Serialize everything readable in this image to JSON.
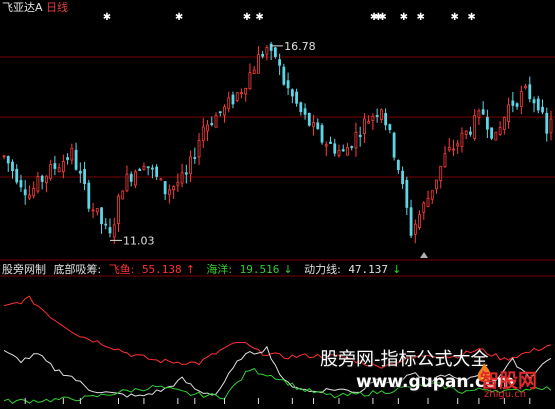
{
  "header": {
    "stock_name": "飞亚达A",
    "period": "日线"
  },
  "price_chart": {
    "high_label": "16.78",
    "low_label": "11.03",
    "ylim": [
      10.6,
      17.6
    ],
    "bar_count": 130,
    "high_index": 63,
    "low_index": 25,
    "anchors": [
      [
        0,
        13.4
      ],
      [
        6,
        12.3
      ],
      [
        10,
        12.9
      ],
      [
        16,
        13.5
      ],
      [
        20,
        12.1
      ],
      [
        25,
        11.03
      ],
      [
        28,
        12.6
      ],
      [
        33,
        13.3
      ],
      [
        38,
        12.4
      ],
      [
        43,
        12.8
      ],
      [
        47,
        14.3
      ],
      [
        52,
        14.8
      ],
      [
        56,
        15.4
      ],
      [
        60,
        16.3
      ],
      [
        63,
        16.78
      ],
      [
        66,
        15.6
      ],
      [
        70,
        14.7
      ],
      [
        75,
        13.9
      ],
      [
        80,
        13.5
      ],
      [
        85,
        14.4
      ],
      [
        89,
        14.9
      ],
      [
        93,
        13.1
      ],
      [
        96,
        11.2
      ],
      [
        100,
        12.2
      ],
      [
        104,
        13.4
      ],
      [
        109,
        14.1
      ],
      [
        113,
        14.7
      ],
      [
        116,
        13.9
      ],
      [
        119,
        14.9
      ],
      [
        123,
        15.3
      ],
      [
        126,
        15.0
      ],
      [
        128,
        14.0
      ],
      [
        129,
        14.6
      ]
    ],
    "star_markers": [
      24,
      41,
      57,
      60,
      87,
      88,
      89,
      94,
      98,
      106,
      110
    ]
  },
  "indicator": {
    "panel_title": "股旁网制",
    "name_label": "底部吸筹:",
    "s1_label": "飞鱼:",
    "s1_value": "55.138",
    "s1_arrow": "↑",
    "s2_label": "海洋:",
    "s2_value": "19.516",
    "s2_arrow": "↓",
    "s3_label": "动力线:",
    "s3_value": "47.137",
    "s3_arrow": "↓",
    "ylim": [
      0,
      100
    ],
    "red_anchors": [
      [
        0,
        78
      ],
      [
        6,
        85
      ],
      [
        12,
        68
      ],
      [
        18,
        55
      ],
      [
        24,
        48
      ],
      [
        30,
        40
      ],
      [
        36,
        35
      ],
      [
        40,
        34
      ],
      [
        46,
        33
      ],
      [
        52,
        45
      ],
      [
        56,
        50
      ],
      [
        60,
        42
      ],
      [
        66,
        38
      ],
      [
        72,
        39
      ],
      [
        80,
        38
      ],
      [
        88,
        30
      ],
      [
        94,
        35
      ],
      [
        100,
        40
      ],
      [
        106,
        38
      ],
      [
        112,
        44
      ],
      [
        118,
        36
      ],
      [
        124,
        42
      ],
      [
        129,
        48
      ]
    ],
    "white_anchors": [
      [
        0,
        42
      ],
      [
        4,
        35
      ],
      [
        8,
        40
      ],
      [
        12,
        28
      ],
      [
        16,
        22
      ],
      [
        20,
        12
      ],
      [
        26,
        8
      ],
      [
        32,
        6
      ],
      [
        38,
        12
      ],
      [
        42,
        20
      ],
      [
        46,
        10
      ],
      [
        50,
        8
      ],
      [
        56,
        38
      ],
      [
        62,
        45
      ],
      [
        66,
        18
      ],
      [
        72,
        10
      ],
      [
        78,
        12
      ],
      [
        84,
        10
      ],
      [
        88,
        22
      ],
      [
        92,
        14
      ],
      [
        96,
        25
      ],
      [
        100,
        18
      ],
      [
        104,
        24
      ],
      [
        108,
        18
      ],
      [
        112,
        25
      ],
      [
        116,
        20
      ],
      [
        120,
        35
      ],
      [
        124,
        22
      ],
      [
        129,
        38
      ]
    ],
    "green_anchors": [
      [
        0,
        2
      ],
      [
        10,
        3
      ],
      [
        20,
        5
      ],
      [
        28,
        10
      ],
      [
        36,
        14
      ],
      [
        44,
        8
      ],
      [
        52,
        6
      ],
      [
        58,
        28
      ],
      [
        64,
        22
      ],
      [
        70,
        12
      ],
      [
        78,
        6
      ],
      [
        84,
        8
      ],
      [
        90,
        10
      ],
      [
        96,
        14
      ],
      [
        102,
        16
      ],
      [
        108,
        10
      ],
      [
        114,
        12
      ],
      [
        120,
        10
      ],
      [
        126,
        14
      ],
      [
        129,
        12
      ]
    ],
    "volume_ticks": [
      5,
      14,
      18,
      27,
      33,
      41,
      45,
      52,
      60,
      68,
      73,
      79,
      87,
      93,
      100,
      107,
      112,
      118,
      124
    ]
  },
  "watermark": {
    "text": "股旁网-指标公式大全",
    "url": "www.gupan.com",
    "logo_text": "智股网",
    "logo_domain": "zhigu.cn"
  },
  "colors": {
    "up": "#ff3b3b",
    "down": "#5ed6e6",
    "grid": "#7a0000",
    "s1": "#ff3030",
    "s2": "#30d030",
    "s3": "#e0e0e0",
    "label_white": "#e0e0e0",
    "label_yellow": "#e6e060"
  }
}
